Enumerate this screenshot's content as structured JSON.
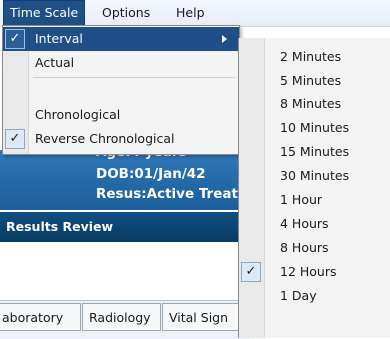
{
  "menubar": {
    "items": [
      {
        "label": "Time Scale",
        "active": true
      },
      {
        "label": "Options",
        "active": false
      },
      {
        "label": "Help",
        "active": false
      }
    ]
  },
  "dropdown": {
    "items": [
      {
        "label": "Interval",
        "checked": true,
        "highlighted": true,
        "submenu": true
      },
      {
        "label": "Actual",
        "checked": false
      },
      {
        "label": "Chronological",
        "checked": false
      },
      {
        "label": "Reverse Chronological",
        "checked": true
      }
    ],
    "check_glyph": "✓"
  },
  "submenu": {
    "items": [
      {
        "label": "2 Minutes",
        "checked": false
      },
      {
        "label": "5 Minutes",
        "checked": false
      },
      {
        "label": "8 Minutes",
        "checked": false
      },
      {
        "label": "10 Minutes",
        "checked": false
      },
      {
        "label": "15 Minutes",
        "checked": false
      },
      {
        "label": "30 Minutes",
        "checked": false
      },
      {
        "label": "1 Hour",
        "checked": false
      },
      {
        "label": "4 Hours",
        "checked": false
      },
      {
        "label": "8 Hours",
        "checked": false
      },
      {
        "label": "12 Hours",
        "checked": true
      },
      {
        "label": "1 Day",
        "checked": false
      }
    ]
  },
  "banner": {
    "line1": "Age:4 years",
    "line2": "DOB:01/Jan/42",
    "line3": "Resus:Active Treat"
  },
  "section": {
    "title": "Results Review"
  },
  "tabs": [
    {
      "label": "aboratory"
    },
    {
      "label": "Radiology"
    },
    {
      "label": "Vital Sign"
    }
  ],
  "colors": {
    "menu_highlight": "#1f4f86",
    "banner": "#2f78b7",
    "section_header": "#0f4f80"
  }
}
